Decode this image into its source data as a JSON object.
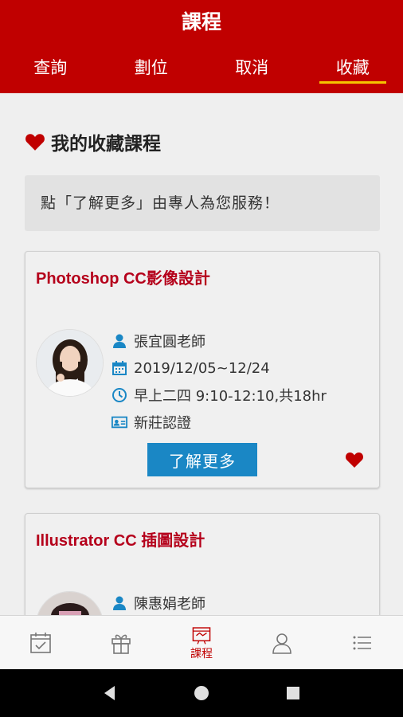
{
  "header": {
    "title": "課程",
    "tabs": [
      {
        "label": "查詢"
      },
      {
        "label": "劃位"
      },
      {
        "label": "取消"
      },
      {
        "label": "收藏"
      }
    ]
  },
  "section": {
    "title": "我的收藏課程",
    "notice": "點「了解更多」由專人為您服務！"
  },
  "courses": [
    {
      "title": "Photoshop CC影像設計",
      "teacher": "張宜圓老師",
      "date": "2019/12/05~12/24",
      "time": "早上二四 9:10-12:10,共18hr",
      "location": "新莊認證",
      "button": "了解更多"
    },
    {
      "title": "Illustrator CC 插圖設計",
      "teacher": "陳惠娟老師"
    }
  ],
  "bottom_nav": {
    "active_label": "課程",
    "items": [
      "calendar-icon",
      "gift-icon",
      "course-icon",
      "user-icon",
      "menu-icon"
    ]
  },
  "colors": {
    "brand_red": "#c00000",
    "tab_underline": "#f5c400",
    "button_blue": "#1a87c5",
    "icon_blue": "#1a87c5",
    "title_red": "#b5001b"
  }
}
